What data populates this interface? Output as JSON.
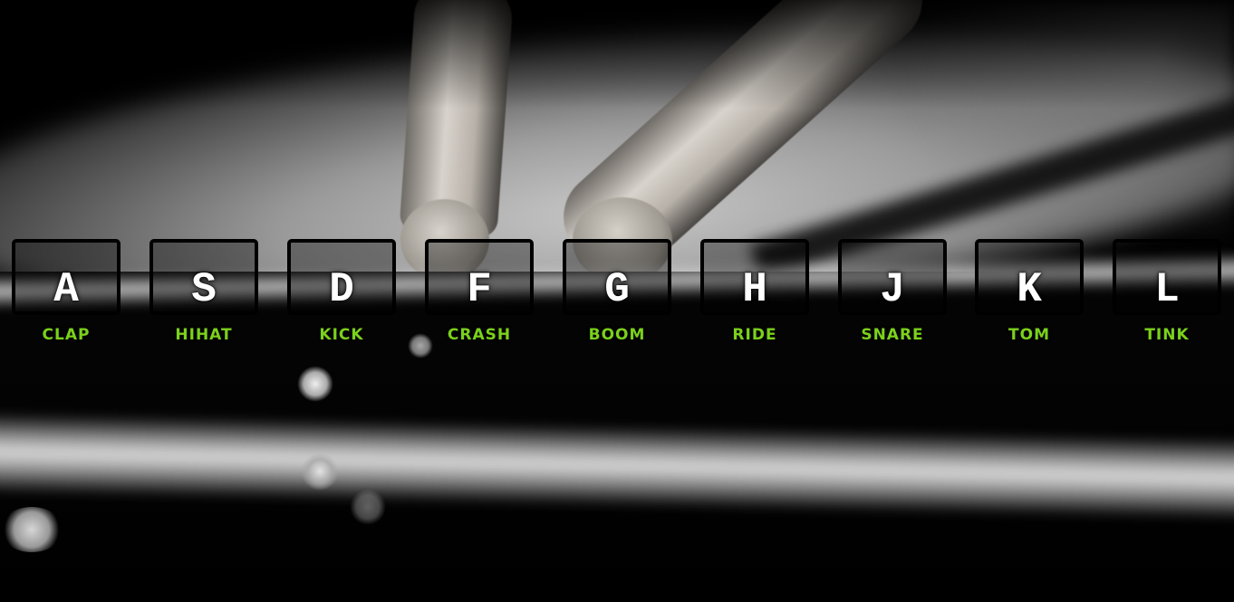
{
  "accent_color": "#7bd11b",
  "keys": [
    {
      "key": "A",
      "sound": "CLAP"
    },
    {
      "key": "S",
      "sound": "HIHAT"
    },
    {
      "key": "D",
      "sound": "KICK"
    },
    {
      "key": "F",
      "sound": "CRASH"
    },
    {
      "key": "G",
      "sound": "BOOM"
    },
    {
      "key": "H",
      "sound": "RIDE"
    },
    {
      "key": "J",
      "sound": "SNARE"
    },
    {
      "key": "K",
      "sound": "TOM"
    },
    {
      "key": "L",
      "sound": "TINK"
    }
  ]
}
